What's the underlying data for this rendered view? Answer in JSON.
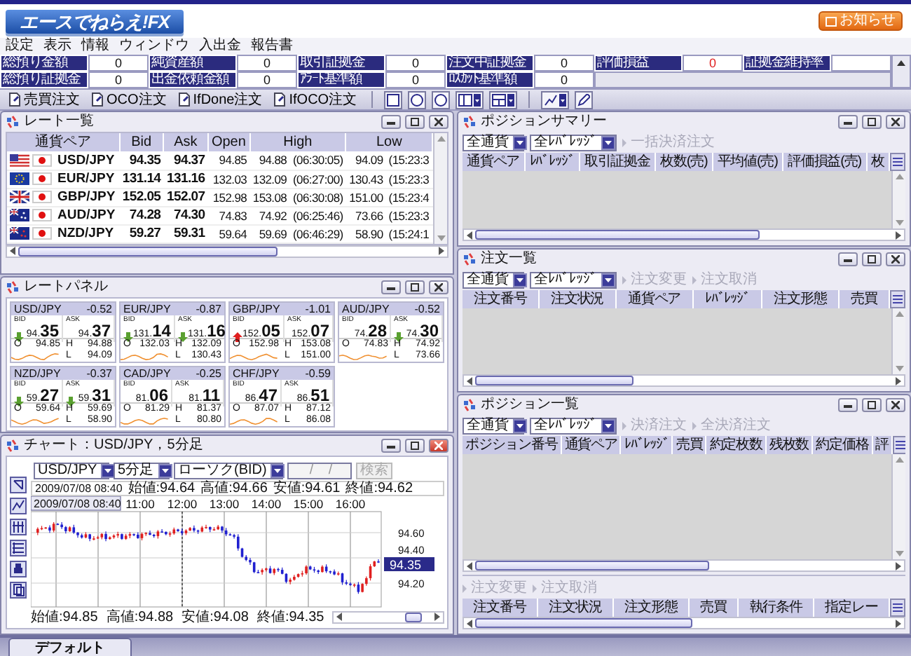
{
  "header": {
    "logo": "エースでねらえ!FX",
    "notice": "お知らせ"
  },
  "menu": [
    "設定",
    "表示",
    "情報",
    "ウィンドウ",
    "入出金",
    "報告書"
  ],
  "account": [
    [
      {
        "label": "総預り金額",
        "value": "0",
        "alert": false
      },
      {
        "label": "純資産額",
        "value": "0",
        "alert": false
      },
      {
        "label": "取引証拠金",
        "value": "0",
        "alert": false
      },
      {
        "label": "注文中証拠金",
        "value": "0",
        "alert": false
      },
      {
        "label": "評価損益",
        "value": "0",
        "alert": true
      },
      {
        "label": "証拠金維持率"
      }
    ],
    [
      {
        "label": "総預り証拠金",
        "value": "0",
        "alert": false
      },
      {
        "label": "出金依頼金額",
        "value": "0",
        "alert": false
      },
      {
        "label": "ｱﾗｰﾄ基準額",
        "value": "0",
        "alert": false
      },
      {
        "label": "ﾛｽｶｯﾄ基準額",
        "value": "0",
        "alert": false
      }
    ]
  ],
  "toolbar": {
    "orders": [
      "売買注文",
      "OCO注文",
      "IfDone注文",
      "IfOCO注文"
    ]
  },
  "rate_list": {
    "title": "レート一覧",
    "active": false,
    "columns": [
      "通貨ペア",
      "Bid",
      "Ask",
      "Open",
      "High",
      "Low"
    ],
    "rows": [
      {
        "flags": [
          {
            "kind": "us"
          },
          {
            "kind": "jp"
          }
        ],
        "pair": "USD/JPY",
        "bid": "94.35",
        "ask": "94.37",
        "open": "94.85",
        "high": "94.88",
        "high_time": "(06:30:05)",
        "low": "94.09",
        "low_time": "(15:23:3"
      },
      {
        "flags": [
          {
            "kind": "eu"
          },
          {
            "kind": "jp"
          }
        ],
        "pair": "EUR/JPY",
        "bid": "131.14",
        "ask": "131.16",
        "open": "132.03",
        "high": "132.09",
        "high_time": "(06:27:00)",
        "low": "130.43",
        "low_time": "(15:23:3"
      },
      {
        "flags": [
          {
            "kind": "gb"
          },
          {
            "kind": "jp"
          }
        ],
        "pair": "GBP/JPY",
        "bid": "152.05",
        "ask": "152.07",
        "open": "152.98",
        "high": "153.08",
        "high_time": "(06:30:08)",
        "low": "151.00",
        "low_time": "(15:23:4"
      },
      {
        "flags": [
          {
            "kind": "au"
          },
          {
            "kind": "jp"
          }
        ],
        "pair": "AUD/JPY",
        "bid": "74.28",
        "ask": "74.30",
        "open": "74.83",
        "high": "74.92",
        "high_time": "(06:25:46)",
        "low": "73.66",
        "low_time": "(15:23:3"
      },
      {
        "flags": [
          {
            "kind": "nz"
          },
          {
            "kind": "jp"
          }
        ],
        "pair": "NZD/JPY",
        "bid": "59.27",
        "ask": "59.31",
        "open": "59.64",
        "high": "59.69",
        "high_time": "(06:46:29)",
        "low": "58.90",
        "low_time": "(15:24:1"
      }
    ]
  },
  "rate_panel": {
    "title": "レートパネル",
    "active": false,
    "cards": [
      {
        "pair": "USD/JPY",
        "change": "-0.52",
        "bid_label": "BID",
        "ask_label": "ASK",
        "bid_prefix": "94.",
        "bid_main": "35",
        "bid_arrow": {
          "kind": "down"
        },
        "ask_prefix": "94.",
        "ask_main": "37",
        "open_label": "O",
        "open": "94.85",
        "high_label": "H",
        "high": "94.88",
        "low_label": "L",
        "low": "94.09"
      },
      {
        "pair": "EUR/JPY",
        "change": "-0.87",
        "bid_label": "BID",
        "ask_label": "ASK",
        "bid_prefix": "131.",
        "bid_main": "14",
        "bid_arrow": {
          "kind": "down"
        },
        "ask_prefix": "131.",
        "ask_main": "16",
        "ask_arrow": {
          "kind": "down"
        },
        "open_label": "O",
        "open": "132.03",
        "high_label": "H",
        "high": "132.09",
        "low_label": "L",
        "low": "130.43"
      },
      {
        "pair": "GBP/JPY",
        "change": "-1.01",
        "bid_label": "BID",
        "ask_label": "ASK",
        "bid_prefix": "152.",
        "bid_main": "05",
        "bid_arrow": {
          "kind": "up"
        },
        "ask_prefix": "152.",
        "ask_main": "07",
        "open_label": "O",
        "open": "152.98",
        "high_label": "H",
        "high": "153.08",
        "low_label": "L",
        "low": "151.00"
      },
      {
        "pair": "AUD/JPY",
        "change": "-0.52",
        "bid_label": "BID",
        "ask_label": "ASK",
        "bid_prefix": "74.",
        "bid_main": "28",
        "ask_prefix": "74.",
        "ask_main": "30",
        "ask_arrow": {
          "kind": "down"
        },
        "open_label": "O",
        "open": "74.83",
        "high_label": "H",
        "high": "74.92",
        "low_label": "L",
        "low": "73.66"
      },
      {
        "pair": "NZD/JPY",
        "change": "-0.37",
        "bid_label": "BID",
        "ask_label": "ASK",
        "bid_prefix": "59.",
        "bid_main": "27",
        "bid_arrow": {
          "kind": "down"
        },
        "ask_prefix": "59.",
        "ask_main": "31",
        "ask_arrow": {
          "kind": "down"
        },
        "open_label": "O",
        "open": "59.64",
        "high_label": "H",
        "high": "59.69",
        "low_label": "L",
        "low": "58.90"
      },
      {
        "pair": "CAD/JPY",
        "change": "-0.25",
        "bid_label": "BID",
        "ask_label": "ASK",
        "bid_prefix": "81.",
        "bid_main": "06",
        "ask_prefix": "81.",
        "ask_main": "11",
        "open_label": "O",
        "open": "81.29",
        "high_label": "H",
        "high": "81.37",
        "low_label": "L",
        "low": "80.80"
      },
      {
        "pair": "CHF/JPY",
        "change": "-0.59",
        "bid_label": "BID",
        "ask_label": "ASK",
        "bid_prefix": "86.",
        "bid_main": "47",
        "ask_prefix": "86.",
        "ask_main": "51",
        "open_label": "O",
        "open": "87.07",
        "high_label": "H",
        "high": "87.12",
        "low_label": "L",
        "low": "86.08"
      }
    ]
  },
  "chart": {
    "title": "チャート：USD/JPY，5分足",
    "active": true,
    "pair": "USD/JPY",
    "period": "5分足",
    "style": "ローソク(BID)",
    "date": "/ /",
    "search": "検索",
    "info_time": "2009/07/08 08:40",
    "info_values": [
      "始値:94.64",
      "高値:94.66",
      "安値:94.61",
      "終値:94.62"
    ],
    "cursor_time": "2009/07/08 08:40",
    "time_labels": [
      "11:00",
      "12:00",
      "13:00",
      "14:00",
      "15:00",
      "16:00"
    ],
    "price_labels": [
      "94.60",
      "94.40",
      "94.20"
    ],
    "current_price": "94.35",
    "summary": [
      "始値:94.85",
      "高値:94.88",
      "安値:94.08",
      "終値:94.35"
    ]
  },
  "position_summary": {
    "title": "ポジションサマリー",
    "active": false,
    "filters": [
      "全通貨",
      "全ﾚﾊﾞﾚｯｼﾞ"
    ],
    "actions": [
      {
        "label": "一括決済注文",
        "disabled": true
      }
    ],
    "columns": [
      "通貨ペア",
      "ﾚﾊﾞﾚｯｼﾞ",
      "取引証拠金",
      "枚数(売)",
      "平均値(売)",
      "評価損益(売)",
      "枚"
    ]
  },
  "order_list": {
    "title": "注文一覧",
    "active": false,
    "filters": [
      "全通貨",
      "全ﾚﾊﾞﾚｯｼﾞ"
    ],
    "actions": [
      {
        "label": "注文変更",
        "disabled": true
      },
      {
        "label": "注文取消",
        "disabled": true
      }
    ],
    "columns": [
      "注文番号",
      "注文状況",
      "通貨ペア",
      "ﾚﾊﾞﾚｯｼﾞ",
      "注文形態",
      "売買"
    ]
  },
  "position_list": {
    "title": "ポジション一覧",
    "active": false,
    "filters": [
      "全通貨",
      "全ﾚﾊﾞﾚｯｼﾞ"
    ],
    "actions": [
      {
        "label": "決済注文",
        "disabled": true
      },
      {
        "label": "全決済注文",
        "disabled": true
      }
    ],
    "columns": [
      "ポジション番号",
      "通貨ペア",
      "ﾚﾊﾞﾚｯｼﾞ",
      "売買",
      "約定枚数",
      "残枚数",
      "約定価格",
      "評"
    ],
    "order_actions": [
      {
        "label": "注文変更",
        "disabled": true
      },
      {
        "label": "注文取消",
        "disabled": true
      }
    ],
    "order_columns": [
      "注文番号",
      "注文状況",
      "注文形態",
      "売買",
      "執行条件",
      "指定レー"
    ]
  },
  "tabs": [
    {
      "label": "デフォルト",
      "selected": true
    }
  ]
}
